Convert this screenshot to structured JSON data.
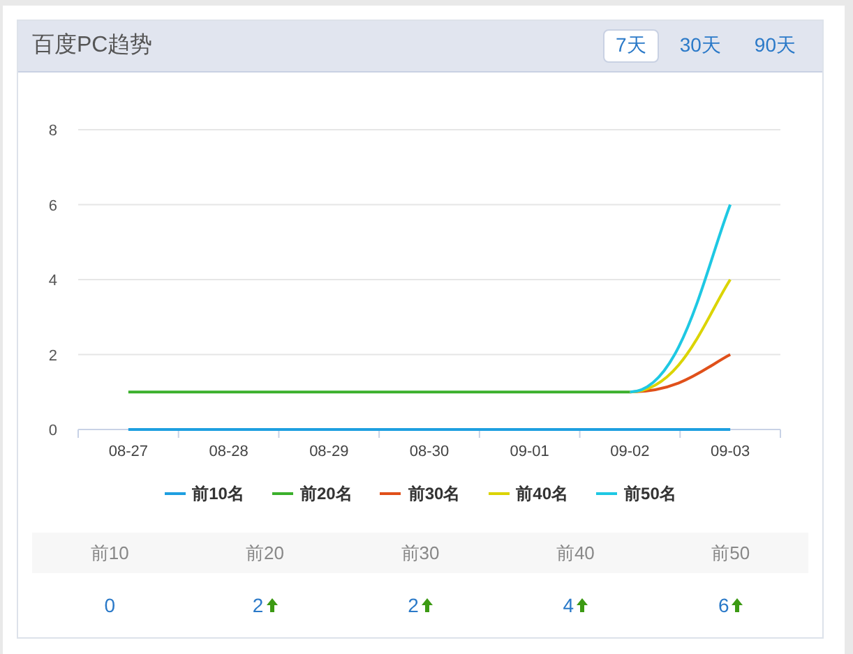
{
  "panel": {
    "title": "百度PC趋势"
  },
  "tabs": [
    {
      "label": "7天",
      "selected": true
    },
    {
      "label": "30天",
      "selected": false
    },
    {
      "label": "90天",
      "selected": false
    }
  ],
  "chart_data": {
    "type": "line",
    "categories": [
      "08-27",
      "08-28",
      "08-29",
      "08-30",
      "09-01",
      "09-02",
      "09-03"
    ],
    "yticks": [
      0,
      2,
      4,
      6,
      8
    ],
    "ylim": [
      0,
      8
    ],
    "grid": true,
    "series": [
      {
        "name": "前10名",
        "color": "#1e9fe0",
        "values": [
          0,
          0,
          0,
          0,
          0,
          0,
          0
        ]
      },
      {
        "name": "前20名",
        "color": "#3bb02c",
        "values": [
          1,
          1,
          1,
          1,
          1,
          1,
          null
        ]
      },
      {
        "name": "前30名",
        "color": "#e0501a",
        "values": [
          null,
          null,
          null,
          null,
          null,
          1,
          2
        ]
      },
      {
        "name": "前40名",
        "color": "#dbd400",
        "values": [
          null,
          null,
          null,
          null,
          null,
          1,
          4
        ]
      },
      {
        "name": "前50名",
        "color": "#1ec8e3",
        "values": [
          null,
          null,
          null,
          null,
          null,
          1,
          6
        ]
      }
    ]
  },
  "summary": [
    {
      "label": "前10",
      "value": "0",
      "up": false
    },
    {
      "label": "前20",
      "value": "2",
      "up": true
    },
    {
      "label": "前30",
      "value": "2",
      "up": true
    },
    {
      "label": "前40",
      "value": "4",
      "up": true
    },
    {
      "label": "前50",
      "value": "6",
      "up": true
    }
  ]
}
